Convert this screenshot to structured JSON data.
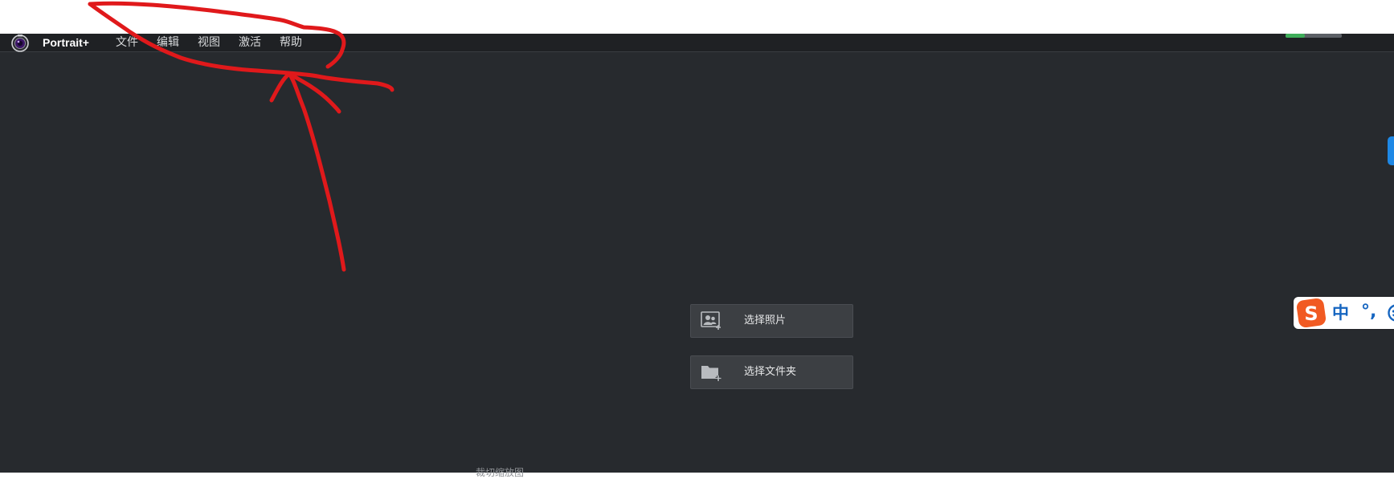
{
  "app": {
    "name": "Portrait+"
  },
  "menu": {
    "items": [
      {
        "label": "文件"
      },
      {
        "label": "编辑"
      },
      {
        "label": "视图"
      },
      {
        "label": "激活"
      },
      {
        "label": "帮助"
      }
    ]
  },
  "actions": {
    "select_photos": "选择照片",
    "select_folder": "选择文件夹"
  },
  "bottom": {
    "text": "裁切缩放图"
  },
  "ime": {
    "mode": "中",
    "punct": "°,"
  },
  "colors": {
    "menubar_bg": "#1f2124",
    "workspace_bg": "#272a2e",
    "button_bg": "#3c3f43",
    "annotation_red": "#e0191b",
    "ime_accent": "#1565c0",
    "sogou_orange": "#f15a22"
  },
  "icons": {
    "app_logo": "camera-lens-icon",
    "select_photos": "add-photo-icon",
    "select_folder": "add-folder-icon",
    "ime_logo": "sogou-s-icon",
    "ime_emoji": "smiley-icon"
  }
}
